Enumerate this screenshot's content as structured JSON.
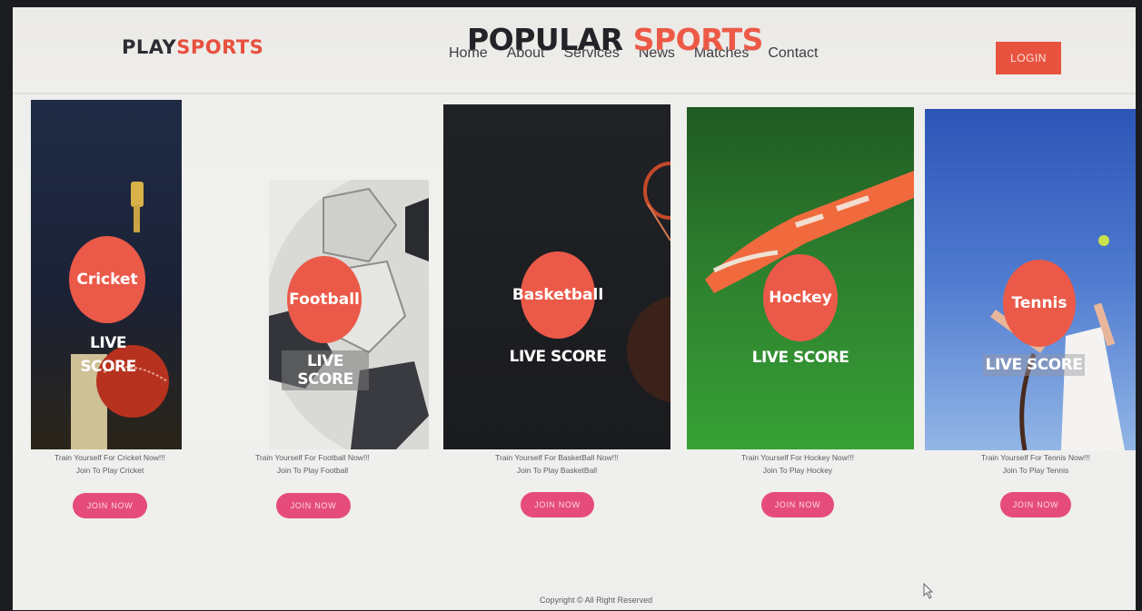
{
  "brand": {
    "part1": "PLAY",
    "part2": "SPORTS"
  },
  "hero": {
    "part1": "POPULAR",
    "part2": "SPORTS"
  },
  "nav": [
    "Home",
    "About",
    "Services",
    "News",
    "Matches",
    "Contact"
  ],
  "login_label": "LOGIN",
  "cards": [
    {
      "title": "Cricket",
      "live1": "LIVE",
      "live2": "SCORE",
      "desc1": "Train Yourself For Cricket Now!!!",
      "desc2": "Join To Play Cricket",
      "join": "JOIN NOW"
    },
    {
      "title": "Football",
      "live": "LIVE SCORE",
      "desc1": "Train Yourself For Football Now!!!",
      "desc2": "Join To Play Football",
      "join": "JOIN NOW"
    },
    {
      "title": "Basketball",
      "live": "LIVE SCORE",
      "desc1": "Train Yourself For BasketBall Now!!!",
      "desc2": "Join To Play BasketBall",
      "join": "JOIN NOW"
    },
    {
      "title": "Hockey",
      "live": "LIVE SCORE",
      "desc1": "Train Yourself For Hockey Now!!!",
      "desc2": "Join To Play Hockey",
      "join": "JOIN NOW"
    },
    {
      "title": "Tennis",
      "live": "LIVE SCORE",
      "desc1": "Train Yourself For Tennis Now!!!",
      "desc2": "Join To Play Tennis",
      "join": "JOIN NOW"
    }
  ],
  "footer": "Copyright © All Right Reserved",
  "colors": {
    "accent": "#e8503e",
    "join": "#e54c7c",
    "dark": "#2d2d33"
  }
}
